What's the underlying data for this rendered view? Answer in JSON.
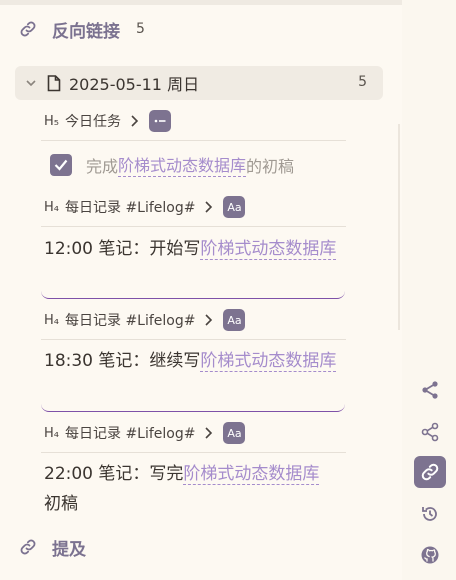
{
  "backlinks": {
    "title": "反向链接",
    "count": "5",
    "document": {
      "title": "2025-05-11 周日",
      "count": "5",
      "entries": [
        {
          "heading_level": "H₅",
          "breadcrumb": "今日任务",
          "badge": "list-icon",
          "task": {
            "checked": true,
            "prefix": "完成",
            "ref": "阶梯式动态数据库",
            "suffix": "的初稿"
          }
        },
        {
          "heading_level": "H₄",
          "breadcrumb": "每日记录 #Lifelog#",
          "badge": "Aa",
          "note": {
            "prefix": "12:00 笔记：开始写",
            "ref": "阶梯式动态数据库",
            "suffix": ""
          }
        },
        {
          "heading_level": "H₄",
          "breadcrumb": "每日记录 #Lifelog#",
          "badge": "Aa",
          "note": {
            "prefix": "18:30 笔记：继续写",
            "ref": "阶梯式动态数据库",
            "suffix": ""
          }
        },
        {
          "heading_level": "H₄",
          "breadcrumb": "每日记录 #Lifelog#",
          "badge": "Aa",
          "note": {
            "prefix": "22:00 笔记：写完",
            "ref": "阶梯式动态数据库",
            "suffix": "初稿"
          }
        }
      ]
    }
  },
  "mentions": {
    "title": "提及"
  },
  "right_rail": {
    "buttons": [
      {
        "icon": "graph-icon",
        "active": false
      },
      {
        "icon": "share-icon",
        "active": false
      },
      {
        "icon": "link-icon",
        "active": true
      },
      {
        "icon": "history-icon",
        "active": false
      },
      {
        "icon": "github-icon",
        "active": false
      }
    ]
  },
  "colors": {
    "accent": "#7d7390",
    "ref_link": "#a58ccc",
    "block_underline": "#7e51a8",
    "background": "#fdf9f2"
  }
}
